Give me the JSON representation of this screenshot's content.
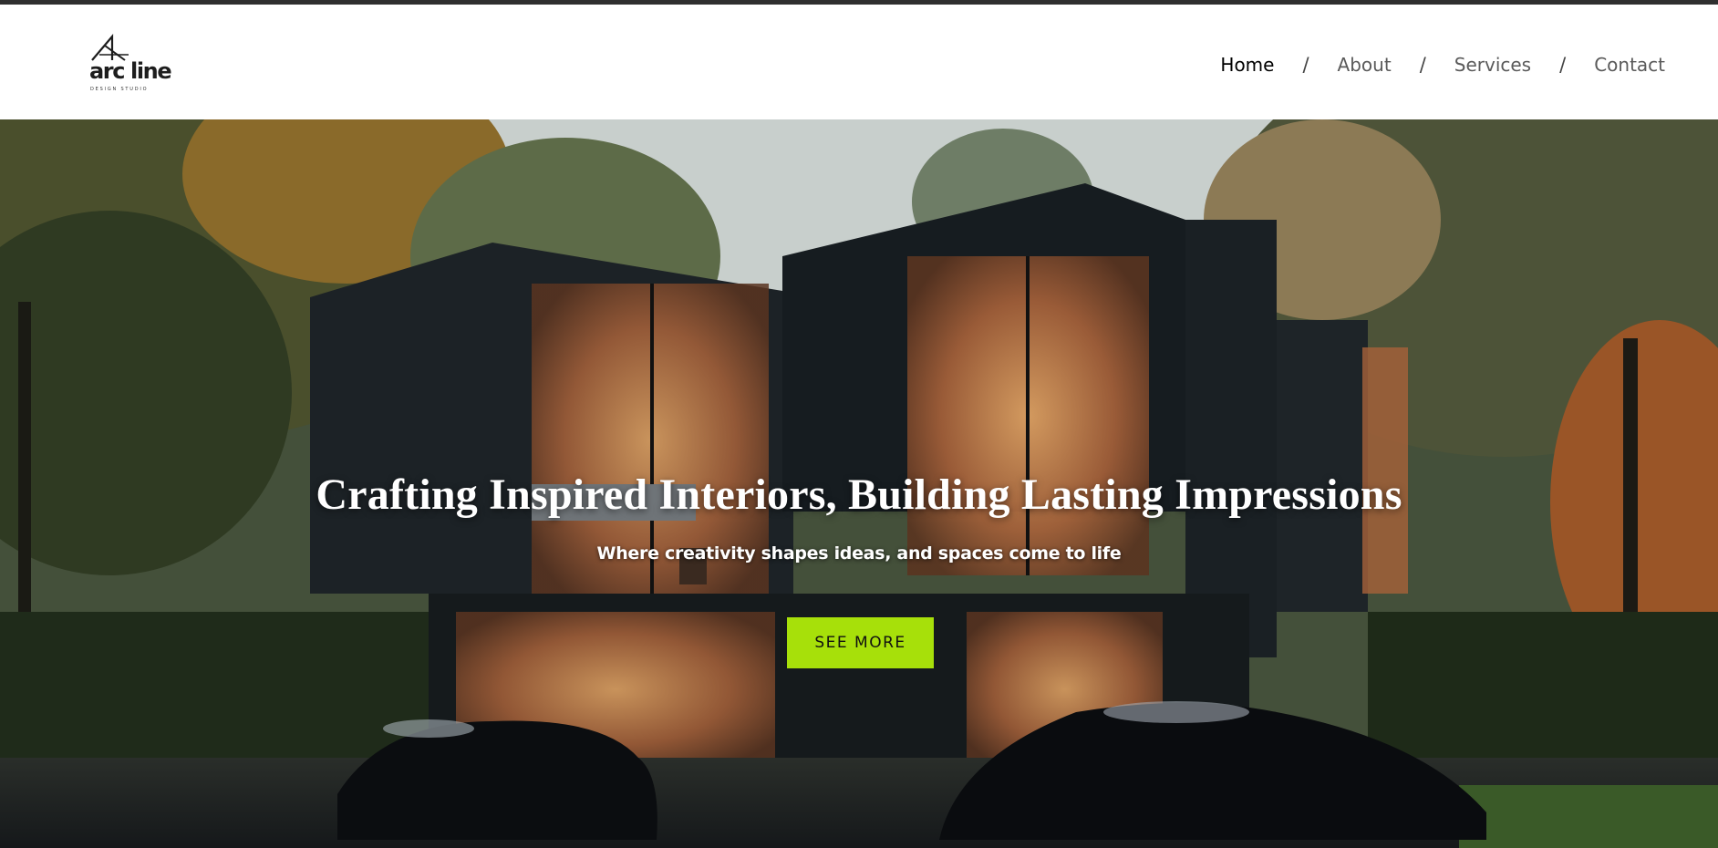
{
  "brand": {
    "name": "arc line",
    "tagline": "DESIGN STUDIO",
    "logo_icon": "triangle-arc-logo-icon"
  },
  "nav": {
    "items": [
      {
        "label": "Home",
        "active": true
      },
      {
        "label": "About",
        "active": false
      },
      {
        "label": "Services",
        "active": false
      },
      {
        "label": "Contact",
        "active": false
      }
    ],
    "separator": "/"
  },
  "hero": {
    "title": "Crafting Inspired Interiors, Building Lasting Impressions",
    "subtitle": "Where creativity shapes ideas, and spaces come to life",
    "cta_label": "SEE MORE",
    "image_subject": "modern-black-house-forest-photo"
  },
  "colors": {
    "accent": "#a7e00a",
    "header_bg": "#ffffff",
    "nav_active": "#000000",
    "nav_inactive": "#5a5a5a"
  }
}
